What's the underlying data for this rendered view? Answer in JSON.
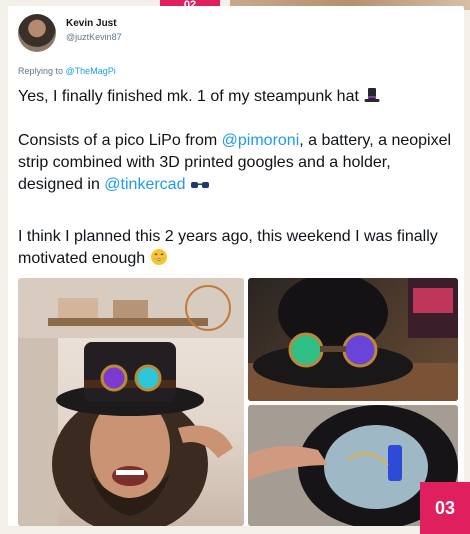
{
  "tweet": {
    "display_name": "Kevin Just",
    "handle": "@juztKevin87",
    "reply_prefix": "Replying to",
    "reply_to": "@TheMagPi",
    "line1": "Yes, I finally finished mk. 1 of my steampunk hat",
    "line2_before": "Consists of a pico LiPo from",
    "mention_pimoroni": "@pimoroni",
    "line2_mid": ", a battery, a neopixel strip combined with 3D printed googles and a holder, designed in",
    "mention_tinkercad": "@tinkercad",
    "line3": "I think I planned this 2 years ago, this weekend I was finally motivated enough",
    "emoji_icons": [
      "top-hat-icon",
      "sunglasses-icon",
      "grin-icon"
    ]
  },
  "badges": {
    "top": "02",
    "bottom": "03"
  },
  "colors": {
    "badge": "#e01f5f",
    "link": "#1d9bf0"
  }
}
